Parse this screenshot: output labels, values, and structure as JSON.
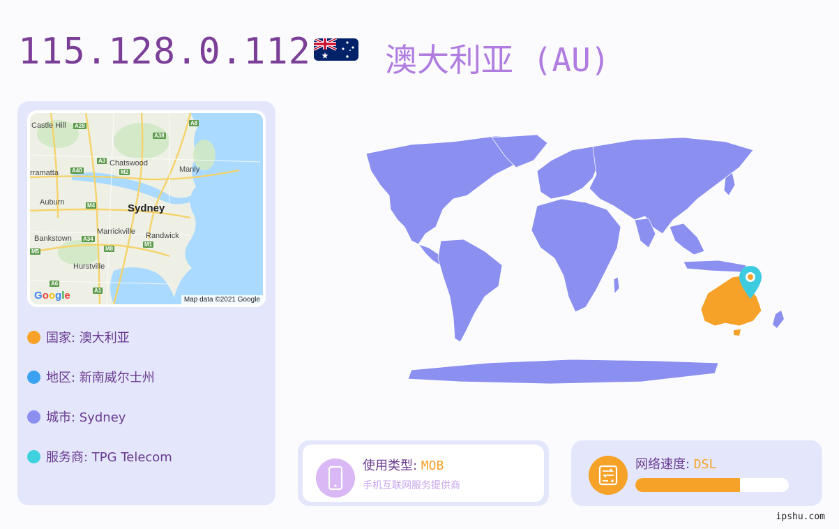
{
  "header": {
    "ip": "115.128.0.112",
    "flag_icon": "australia-flag-icon",
    "country_title": "澳大利亚 (AU)"
  },
  "map": {
    "labels": {
      "castle_hill": "Castle Hill",
      "parramatta": "rramatta",
      "chatswood": "Chatswood",
      "manly": "Manly",
      "auburn": "Auburn",
      "sydney": "Sydney",
      "marrickville": "Marrickville",
      "randwick": "Randwick",
      "bankstown": "Bankstown",
      "hurstville": "Hurstville"
    },
    "roads": {
      "a28": "A28",
      "a8": "A8",
      "a38": "A38",
      "a3": "A3",
      "a40": "A40",
      "m2": "M2",
      "m4": "M4",
      "a34": "A34",
      "m1": "M1",
      "m8": "M8",
      "m5": "M5",
      "a6": "A6",
      "a1": "A1"
    },
    "google": "Google",
    "attribution": "Map data ©2021 Google"
  },
  "info": [
    {
      "label": "国家: 澳大利亚",
      "color": "#f6a127"
    },
    {
      "label": "地区: 新南威尔士州",
      "color": "#3aa2f0"
    },
    {
      "label": "城市: Sydney",
      "color": "#8a8ff0"
    },
    {
      "label": "服务商: TPG Telecom",
      "color": "#3dd2de"
    }
  ],
  "usage": {
    "title": "使用类型: ",
    "value": "MOB",
    "desc": "手机互联网服务提供商",
    "icon": "mobile-phone-icon"
  },
  "speed": {
    "title": "网络速度: ",
    "value": "DSL",
    "level": 0.68,
    "icon": "network-drive-icon"
  },
  "footer": {
    "site": "ipshu.com"
  },
  "colors": {
    "accent": "#7b3f98",
    "highlight": "#f6a127",
    "world": "#8a8ff0",
    "pin": "#3dcbe0"
  }
}
